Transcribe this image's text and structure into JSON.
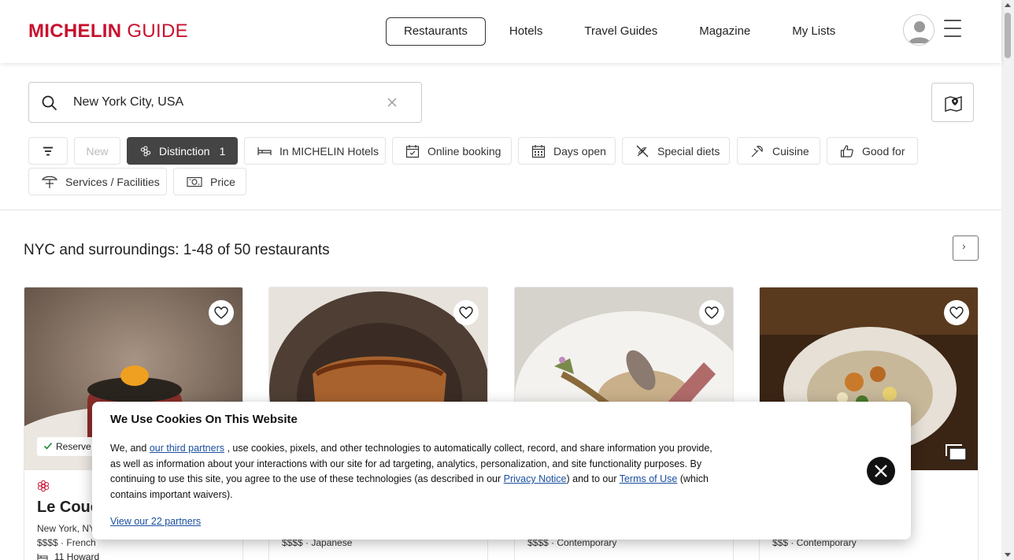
{
  "header": {
    "logo_bold": "MICHELIN",
    "logo_light": "GUIDE",
    "nav": [
      {
        "label": "Restaurants",
        "active": true
      },
      {
        "label": "Hotels",
        "active": false
      },
      {
        "label": "Travel Guides",
        "active": false
      },
      {
        "label": "Magazine",
        "active": false
      },
      {
        "label": "My Lists",
        "active": false
      }
    ]
  },
  "search": {
    "value": "New York City, USA"
  },
  "filters": {
    "row1": [
      {
        "label": "",
        "icon": "sliders-icon"
      },
      {
        "label": "New",
        "disabled": true
      },
      {
        "label": "Distinction",
        "count": "1",
        "icon": "distinction-flower-icon",
        "selected": true
      },
      {
        "label": "In MICHELIN Hotels",
        "icon": "bed-icon"
      },
      {
        "label": "Online booking",
        "icon": "calendar-check-icon"
      },
      {
        "label": "Days open",
        "icon": "calendar-grid-icon"
      },
      {
        "label": "Special diets",
        "icon": "wheat-crossed-icon"
      },
      {
        "label": "Cuisine",
        "icon": "cuisine-icon"
      },
      {
        "label": "Good for",
        "icon": "thumbs-up-icon"
      }
    ],
    "row2": [
      {
        "label": "Services / Facilities",
        "icon": "umbrella-table-icon"
      },
      {
        "label": "Price",
        "icon": "banknote-icon"
      }
    ]
  },
  "results": {
    "title": "NYC and surroundings: 1-48 of 50 restaurants"
  },
  "cards": [
    {
      "name": "Le Couc",
      "location": "New York, NY",
      "meta": "$$$$ · French",
      "hotel": "11 Howard",
      "reserve": "Reserve",
      "image_colors": [
        "#8a7a6a",
        "#5a3a2a"
      ]
    },
    {
      "name": "",
      "location": "",
      "meta": "$$$$ · Japanese",
      "image_colors": [
        "#4a3a30",
        "#a86a3a"
      ]
    },
    {
      "name": "",
      "location": "",
      "meta": "$$$$ · Contemporary",
      "image_colors": [
        "#e8e6e2",
        "#9a7a5a"
      ]
    },
    {
      "name": "",
      "location": "",
      "meta": "$$$ · Contemporary",
      "image_colors": [
        "#3a2a1a",
        "#d8cfc0"
      ]
    }
  ],
  "cookie": {
    "title": "We Use Cookies On This Website",
    "body_1": "We, and ",
    "link_partners": "our third partners",
    "body_2": " , use cookies, pixels, and other technologies to automatically collect, record, and share information you provide, as well as information about your interactions with our site for ad targeting, analytics, personalization, and site functionality purposes. By continuing to use this site, you agree to the use of these technologies (as described in our ",
    "link_privacy": "Privacy Notice",
    "body_3": ") and to our ",
    "link_terms": "Terms of Use",
    "body_4": " (which contains important waivers).",
    "view_partners": "View our 22 partners"
  },
  "colors": {
    "brand": "#c8102e",
    "link": "#1a4fa0",
    "chip_selected": "#444444"
  }
}
